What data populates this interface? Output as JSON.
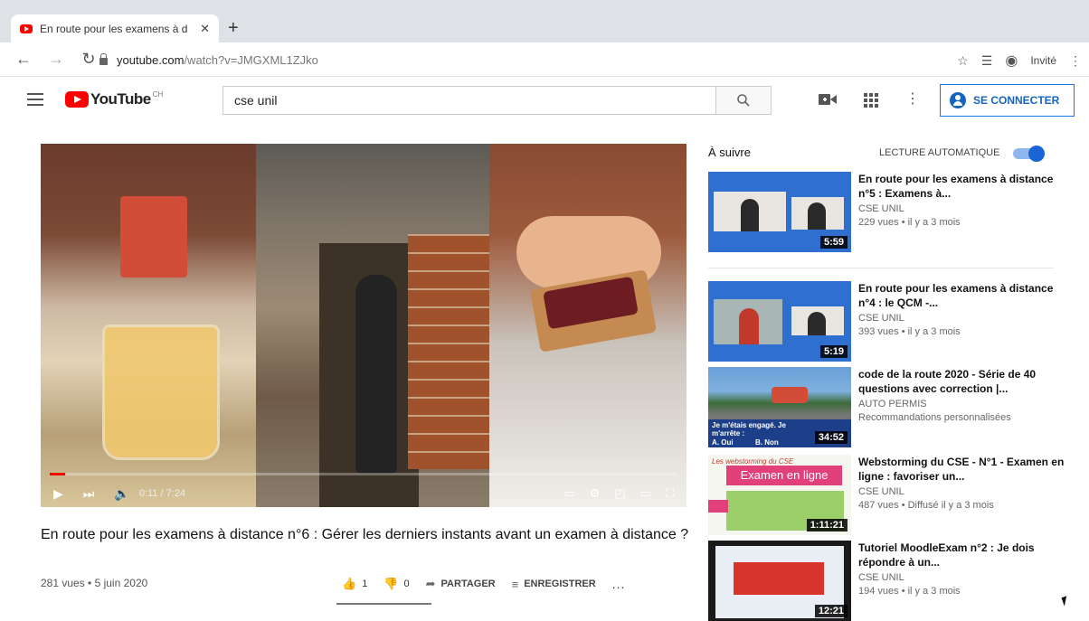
{
  "browser": {
    "tab_title": "En route pour les examens à d",
    "tab_close": "✕",
    "new_tab": "+",
    "url_host": "youtube.com",
    "url_path": "/watch?v=JMGXML1ZJko",
    "profile_label": "Invité"
  },
  "youtube": {
    "logo_text": "YouTube",
    "region": "CH",
    "search_value": "cse unil",
    "signin_label": "SE CONNECTER"
  },
  "player": {
    "time": "0:11 / 7:24",
    "progress_fraction": 0.025
  },
  "video": {
    "title": "En route pour les examens à distance n°6 : Gérer les derniers instants avant un examen à distance ?",
    "meta": "281 vues • 5 juin 2020",
    "likes": "1",
    "dislikes": "0",
    "share_label": "PARTAGER",
    "save_label": "ENREGISTRER",
    "more": "..."
  },
  "sidebar": {
    "up_next": "À suivre",
    "autoplay": "LECTURE AUTOMATIQUE",
    "autoplay_on": true,
    "items": [
      {
        "title": "En route pour les examens à distance n°5 : Examens à...",
        "channel": "CSE UNIL",
        "meta": "229 vues • il y a 3 mois",
        "duration": "5:59"
      },
      {
        "title": "En route pour les examens à distance n°4 : le QCM -...",
        "channel": "CSE UNIL",
        "meta": "393 vues • il y a 3 mois",
        "duration": "5:19"
      },
      {
        "title": "code de la route 2020 - Série de 40 questions avec correction |...",
        "channel": "AUTO PERMIS",
        "meta": "Recommandations personnalisées",
        "duration": "34:52"
      },
      {
        "title": "Webstorming du CSE - N°1 - Examen en ligne : favoriser un...",
        "channel": "CSE UNIL",
        "meta": "487 vues • Diffusé il y a 3 mois",
        "duration": "1:11:21"
      },
      {
        "title": "Tutoriel MoodleExam n°2 : Je dois répondre à un...",
        "channel": "CSE UNIL",
        "meta": "194 vues • il y a 3 mois",
        "duration": "12:21"
      }
    ]
  },
  "thumb_texts": {
    "code_caption": "Je m'étais engagé. Je m'arrête :",
    "code_a": "A. Oui",
    "code_b": "B. Non",
    "web_header": "Les webstorming du CSE",
    "web_title": "Examen en ligne"
  },
  "colors": {
    "youtube_red": "#ff0000",
    "signin_blue": "#1565c0",
    "thumb_blue": "#2f6fd0"
  }
}
